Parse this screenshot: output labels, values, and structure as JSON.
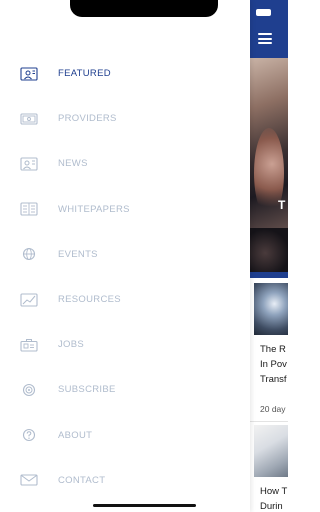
{
  "colors": {
    "brand": "#1f3f8f",
    "menu_inactive": "#b0bccd",
    "menu_active": "#1f3f8f"
  },
  "drawer": {
    "items": [
      {
        "label": "FEATURED",
        "icon": "featured-icon",
        "active": true
      },
      {
        "label": "PROVIDERS",
        "icon": "providers-icon",
        "active": false
      },
      {
        "label": "NEWS",
        "icon": "news-icon",
        "active": false
      },
      {
        "label": "WHITEPAPERS",
        "icon": "whitepapers-icon",
        "active": false
      },
      {
        "label": "EVENTS",
        "icon": "globe-icon",
        "active": false
      },
      {
        "label": "RESOURCES",
        "icon": "resources-icon",
        "active": false
      },
      {
        "label": "JOBS",
        "icon": "briefcase-icon",
        "active": false
      },
      {
        "label": "SUBSCRIBE",
        "icon": "subscribe-icon",
        "active": false
      },
      {
        "label": "ABOUT",
        "icon": "question-icon",
        "active": false
      },
      {
        "label": "CONTACT",
        "icon": "envelope-icon",
        "active": false
      }
    ]
  },
  "background": {
    "header": {
      "menu_icon": "hamburger-icon"
    },
    "hero": {
      "overlay_text": "T"
    },
    "cards": [
      {
        "title": "The R\nIn Pov\nTransf",
        "date": "20 day"
      },
      {
        "title": "How T\nDurin"
      }
    ]
  }
}
